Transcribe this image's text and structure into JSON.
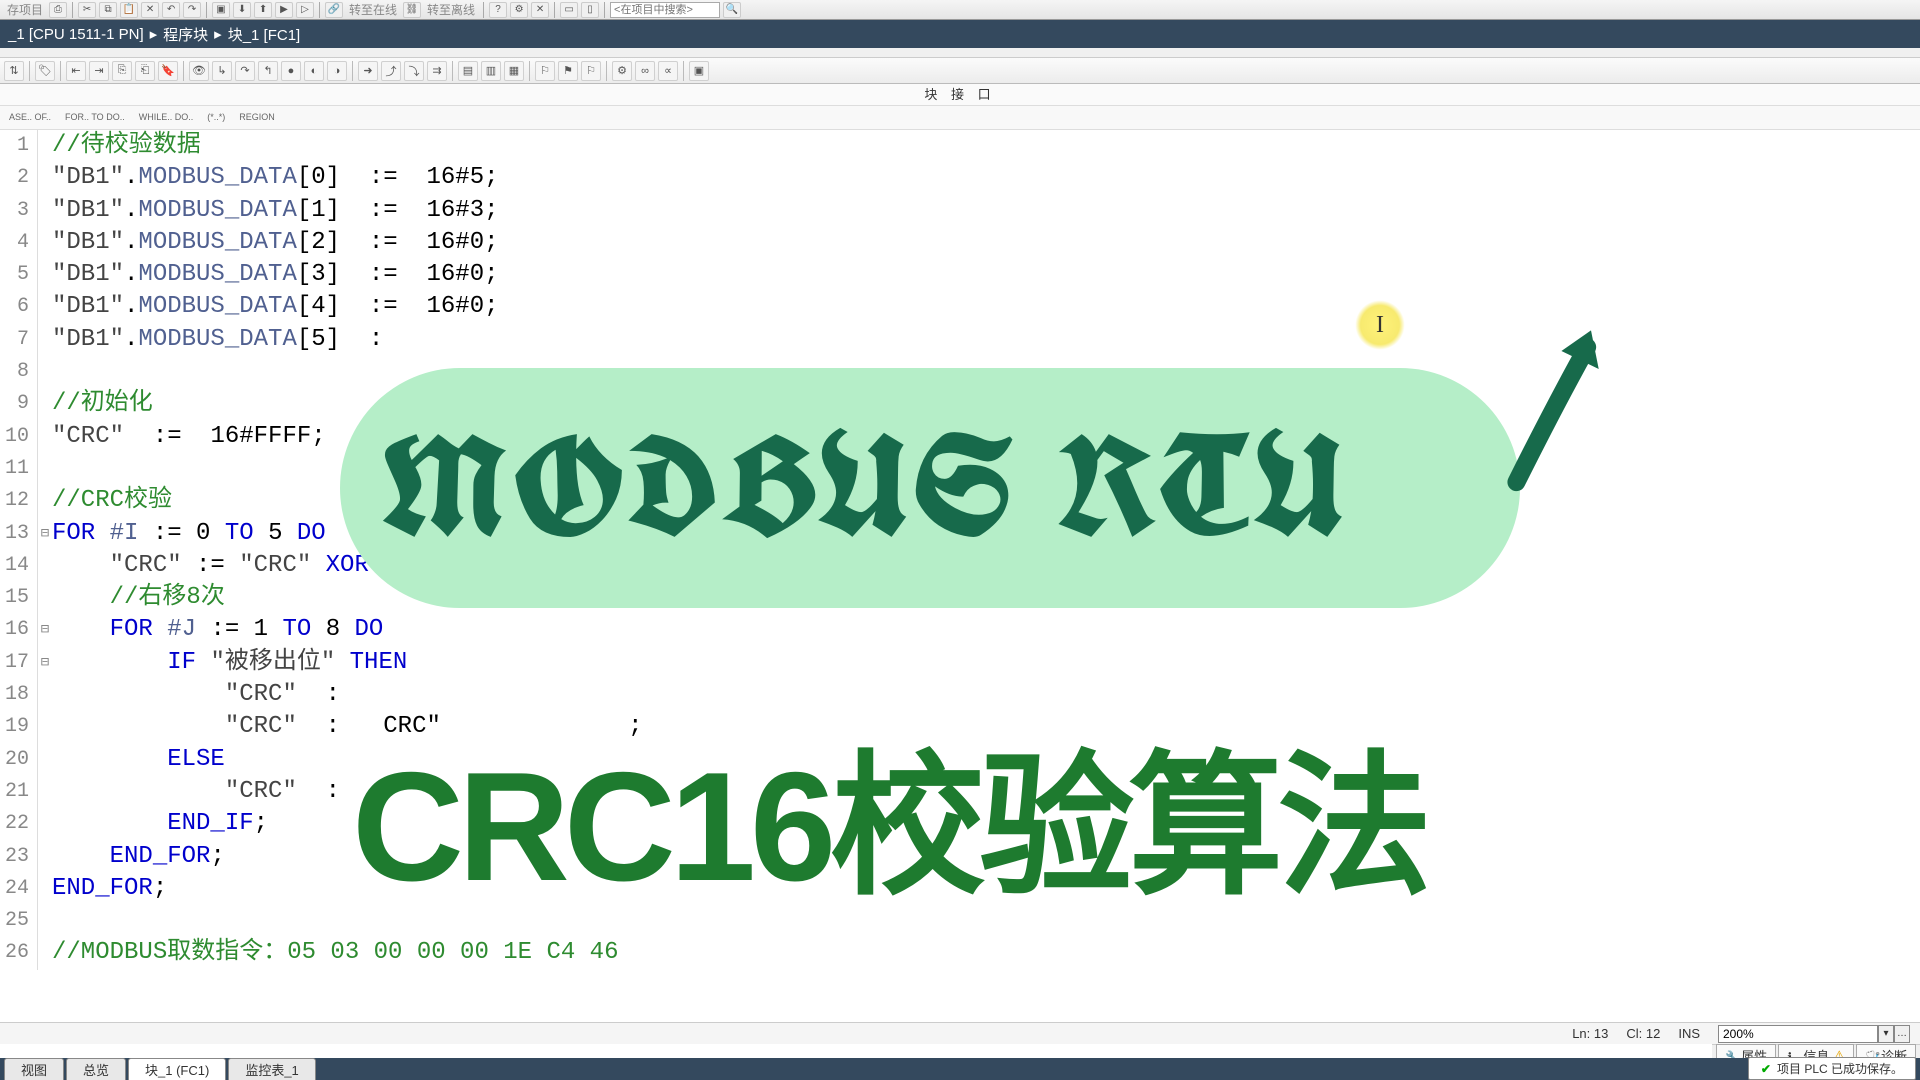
{
  "toptoolbar": {
    "save_label": "存项目",
    "online_label": "转至在线",
    "offline_label": "转至离线",
    "search_placeholder": "<在项目中搜索>"
  },
  "breadcrumb": {
    "seg1": "_1 [CPU 1511-1 PN]",
    "seg2": "程序块",
    "seg3": "块_1 [FC1]"
  },
  "blockiface": "块 接 口",
  "snippets": [
    "ASE..\nOF..",
    "FOR..\nTO DO..",
    "WHILE..\nDO..",
    "(*..*)",
    "REGION"
  ],
  "code": {
    "lines": [
      {
        "n": "1",
        "fold": "",
        "html": "<span class='tok-comment'>//待校验数据</span>"
      },
      {
        "n": "2",
        "fold": "",
        "html": "<span class='tok-string'>\"DB1\"</span>.<span class='tok-ident'>MODBUS_DATA</span>[<span class='tok-num'>0</span>]  :=  <span class='tok-num'>16#5</span>;"
      },
      {
        "n": "3",
        "fold": "",
        "html": "<span class='tok-string'>\"DB1\"</span>.<span class='tok-ident'>MODBUS_DATA</span>[<span class='tok-num'>1</span>]  :=  <span class='tok-num'>16#3</span>;"
      },
      {
        "n": "4",
        "fold": "",
        "html": "<span class='tok-string'>\"DB1\"</span>.<span class='tok-ident'>MODBUS_DATA</span>[<span class='tok-num'>2</span>]  :=  <span class='tok-num'>16#0</span>;"
      },
      {
        "n": "5",
        "fold": "",
        "html": "<span class='tok-string'>\"DB1\"</span>.<span class='tok-ident'>MODBUS_DATA</span>[<span class='tok-num'>3</span>]  :=  <span class='tok-num'>16#0</span>;"
      },
      {
        "n": "6",
        "fold": "",
        "html": "<span class='tok-string'>\"DB1\"</span>.<span class='tok-ident'>MODBUS_DATA</span>[<span class='tok-num'>4</span>]  :=  <span class='tok-num'>16#0</span>;"
      },
      {
        "n": "7",
        "fold": "",
        "html": "<span class='tok-string'>\"DB1\"</span>.<span class='tok-ident'>MODBUS_DATA</span>[<span class='tok-num'>5</span>]  :"
      },
      {
        "n": "8",
        "fold": "",
        "html": ""
      },
      {
        "n": "9",
        "fold": "",
        "html": "<span class='tok-comment'>//初始化</span>"
      },
      {
        "n": "10",
        "fold": "",
        "html": "<span class='tok-string'>\"CRC\"</span>  :=  <span class='tok-num'>16#FFFF</span>;"
      },
      {
        "n": "11",
        "fold": "",
        "html": ""
      },
      {
        "n": "12",
        "fold": "",
        "html": "<span class='tok-comment'>//CRC校验</span>"
      },
      {
        "n": "13",
        "fold": "⊟",
        "html": "<span class='tok-keyword'>FOR</span> <span class='tok-ident'>#I</span> := <span class='tok-num'>0</span> <span class='tok-keyword'>TO</span> <span class='tok-num'>5</span> <span class='tok-keyword'>DO</span>"
      },
      {
        "n": "14",
        "fold": "",
        "html": "    <span class='tok-string'>\"CRC\"</span> := <span class='tok-string'>\"CRC\"</span> <span class='tok-keyword'>XOR</span> <span class='tok-string'>\"DB1\"</span>.<span class='tok-ident'>MODBUS_DATA</span>[<span class='tok-ident'>#I</span>];"
      },
      {
        "n": "15",
        "fold": "",
        "html": "    <span class='tok-comment'>//右移8次</span>"
      },
      {
        "n": "16",
        "fold": "⊟",
        "html": "    <span class='tok-keyword'>FOR</span> <span class='tok-ident'>#J</span> := <span class='tok-num'>1</span> <span class='tok-keyword'>TO</span> <span class='tok-num'>8</span> <span class='tok-keyword'>DO</span>"
      },
      {
        "n": "17",
        "fold": "⊟",
        "html": "        <span class='tok-keyword'>IF</span> <span class='tok-string'>\"被移出位\"</span> <span class='tok-keyword'>THEN</span>"
      },
      {
        "n": "18",
        "fold": "",
        "html": "            <span class='tok-string'>\"CRC\"</span>  :"
      },
      {
        "n": "19",
        "fold": "",
        "html": "            <span class='tok-string'>\"CRC\"</span>  :   CRC\"             ;"
      },
      {
        "n": "20",
        "fold": "",
        "html": "        <span class='tok-keyword'>ELSE</span>"
      },
      {
        "n": "21",
        "fold": "",
        "html": "            <span class='tok-string'>\"CRC\"</span>  :                     1"
      },
      {
        "n": "22",
        "fold": "",
        "html": "        <span class='tok-keyword'>END_IF</span>;"
      },
      {
        "n": "23",
        "fold": "",
        "html": "    <span class='tok-keyword'>END_FOR</span>;"
      },
      {
        "n": "24",
        "fold": "",
        "html": "<span class='tok-keyword'>END_FOR</span>;"
      },
      {
        "n": "25",
        "fold": "",
        "html": ""
      },
      {
        "n": "26",
        "fold": "",
        "html": "<span class='tok-comment'>//MODBUS取数指令：05 03 00 00 00 1E C4 46</span>"
      }
    ]
  },
  "overlay": {
    "title": "MODBUS RTU",
    "subtitle": "CRC16校验算法",
    "cursor": "I"
  },
  "status": {
    "ln": "Ln: 13",
    "col": "Cl: 12",
    "ins": "INS",
    "zoom": "200%"
  },
  "props": {
    "prop": "属性",
    "info": "信息",
    "diag": "诊断"
  },
  "tabs": {
    "t1": "视图",
    "t2": "总览",
    "t3": "块_1 (FC1)",
    "t4": "监控表_1",
    "msg": "项目 PLC 已成功保存。"
  }
}
